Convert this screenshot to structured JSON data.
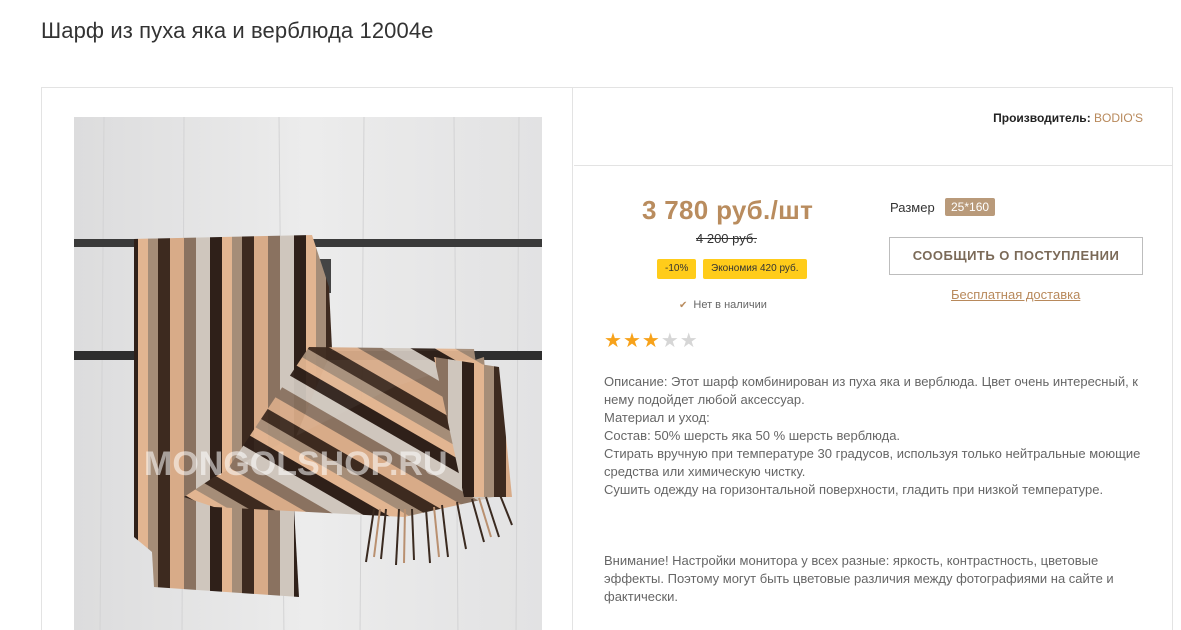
{
  "product": {
    "title": "Шарф из пуха яка и верблюда 12004е",
    "watermark": "MONGOLSHOP.RU",
    "manufacturer_label": "Производитель:",
    "manufacturer_name": "BODIO'S",
    "price": "3 780 руб./шт",
    "old_price": "4 200 руб.",
    "discount_badge": "-10%",
    "saving_badge": "Экономия 420 руб.",
    "stock_status": "Нет в наличии",
    "size_label": "Размер",
    "size_value": "25*160",
    "notify_button": "СООБЩИТЬ О ПОСТУПЛЕНИИ",
    "delivery_link": "Бесплатная доставка",
    "rating": {
      "value": 3,
      "max": 5,
      "star_char": "★"
    },
    "description": [
      "Описание: Этот шарф комбинирован из пуха яка и верблюда. Цвет очень интересный, к нему подойдет любой аксессуар.",
      "Материал и уход:",
      "Состав: 50% шерсть яка 50 % шерсть верблюда.",
      "Стирать вручную при температуре 30 градусов, используя только нейтральные моющие средства или химическую чистку.",
      "Сушить одежду на горизонтальной поверхности, гладить при низкой температуре."
    ],
    "notice": "Внимание! Настройки монитора у всех разные: яркость, контрастность, цветовые эффекты. Поэтому могут быть цветовые различия между фотографиями на сайте и фактически."
  },
  "colors": {
    "accent": "#b98c5e",
    "badge": "#ffcc1a",
    "star_on": "#f7a21a",
    "star_off": "#d6d6d6"
  },
  "icons": {
    "stock": "check-icon"
  }
}
